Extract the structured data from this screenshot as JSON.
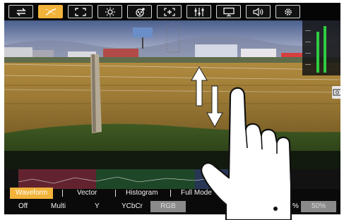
{
  "toolbar": {
    "buttons": [
      {
        "icon": "swap-arrows-icon",
        "active": false
      },
      {
        "icon": "curve-icon",
        "active": true
      },
      {
        "icon": "expand-icon",
        "active": false
      },
      {
        "icon": "brightness-icon",
        "active": false
      },
      {
        "icon": "color-palette-icon",
        "active": false
      },
      {
        "icon": "focus-plus-icon",
        "active": false
      },
      {
        "icon": "sliders-icon",
        "active": false
      },
      {
        "icon": "monitor-icon",
        "active": false
      },
      {
        "icon": "speaker-icon",
        "active": false
      },
      {
        "icon": "gear-icon",
        "active": false
      }
    ]
  },
  "menu": {
    "modes": [
      "Waveform",
      "Vector",
      "Histogram",
      "Full Mode"
    ],
    "selected_mode": "Waveform",
    "options": [
      "Off",
      "Multi",
      "Y",
      "YCbCr",
      "RGB"
    ],
    "highlighted_option": "RGB",
    "level_partial": "%",
    "level_value": "50%"
  },
  "colors": {
    "accent": "#f2b33a",
    "meter_green": "#2ecc40",
    "option_box": "#8a8a8a"
  }
}
